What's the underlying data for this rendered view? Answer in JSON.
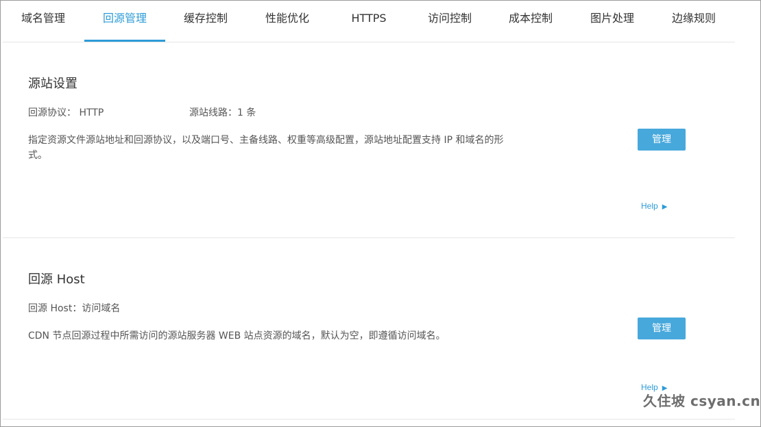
{
  "tabs": [
    {
      "label": "域名管理",
      "active": false
    },
    {
      "label": "回源管理",
      "active": true
    },
    {
      "label": "缓存控制",
      "active": false
    },
    {
      "label": "性能优化",
      "active": false
    },
    {
      "label": "HTTPS",
      "active": false
    },
    {
      "label": "访问控制",
      "active": false
    },
    {
      "label": "成本控制",
      "active": false
    },
    {
      "label": "图片处理",
      "active": false
    },
    {
      "label": "边缘规则",
      "active": false
    }
  ],
  "origin_settings": {
    "title": "源站设置",
    "protocol": "回源协议： HTTP",
    "lines": "源站线路：1 条",
    "description": "指定资源文件源站地址和回源协议，以及端口号、主备线路、权重等高级配置，源站地址配置支持 IP 和域名的形式。",
    "manage_label": "管理",
    "help_label": "Help"
  },
  "origin_host": {
    "title": "回源 Host",
    "host": "回源 Host：访问域名",
    "description": "CDN 节点回源过程中所需访问的源站服务器 WEB 站点资源的域名，默认为空，即遵循访问域名。",
    "manage_label": "管理",
    "help_label": "Help"
  },
  "watermark": "久住坡 csyan.cn",
  "colors": {
    "accent": "#2d9bd8",
    "button": "#47a8dc"
  }
}
